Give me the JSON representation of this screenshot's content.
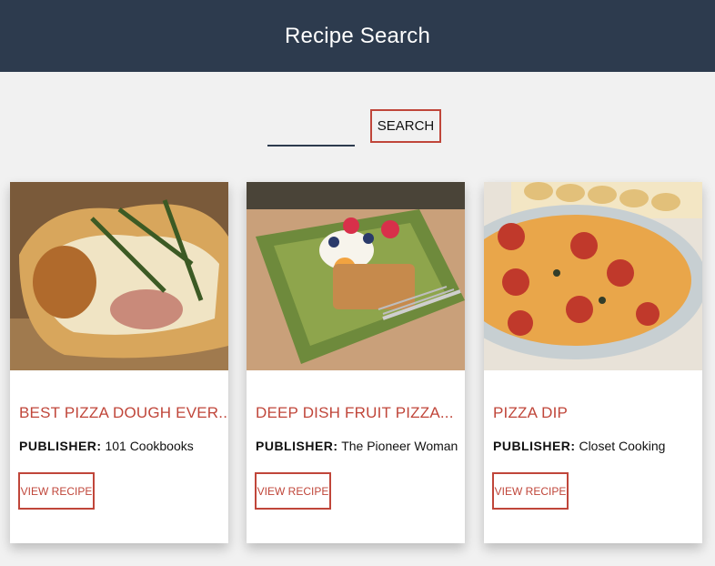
{
  "header": {
    "title": "Recipe Search"
  },
  "search": {
    "input_value": "",
    "button_label": "SEARCH"
  },
  "publisher_label": "PUBLISHER:",
  "cards": [
    {
      "title": "BEST PIZZA DOUGH EVER...",
      "publisher": "101 Cookbooks",
      "button_label": "VIEW RECIPE"
    },
    {
      "title": "DEEP DISH FRUIT PIZZA...",
      "publisher": "The Pioneer Woman",
      "button_label": "VIEW RECIPE"
    },
    {
      "title": "PIZZA DIP",
      "publisher": "Closet Cooking",
      "button_label": "VIEW RECIPE"
    }
  ],
  "colors": {
    "header_bg": "#2d3b4e",
    "accent": "#c0463a",
    "page_bg": "#f1f1f1"
  }
}
